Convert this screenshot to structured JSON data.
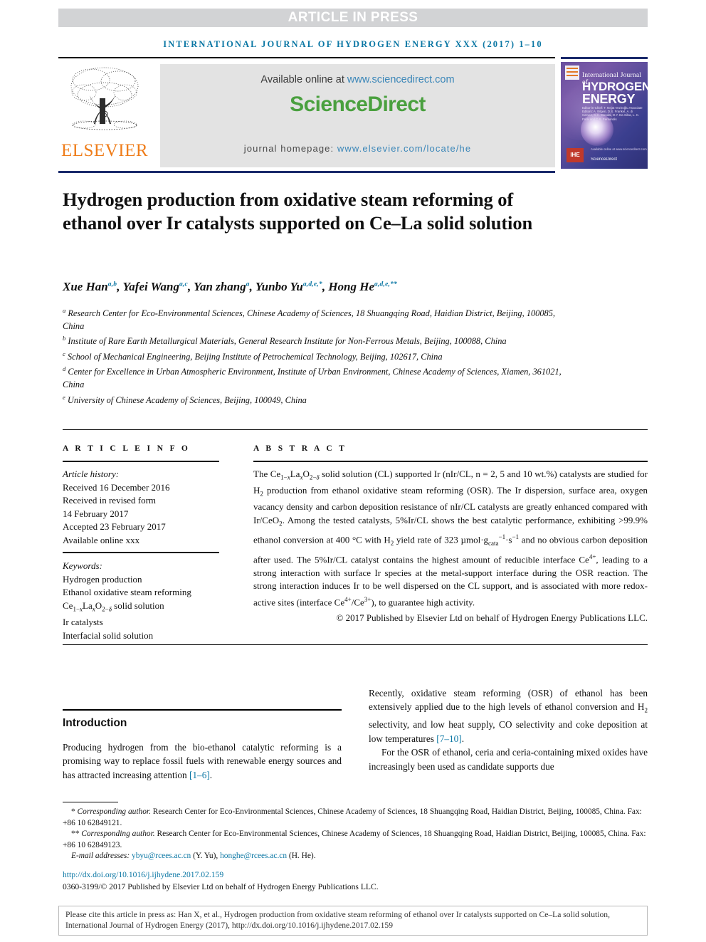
{
  "banner": {
    "article_in_press": "ARTICLE IN PRESS",
    "journal_running_head": "INTERNATIONAL JOURNAL OF HYDROGEN ENERGY XXX (2017) 1–10"
  },
  "masthead": {
    "elsevier_wordmark": "ELSEVIER",
    "available_online_label": "Available online at",
    "sciencedirect_url": "www.sciencedirect.com",
    "sciencedirect_logo": "ScienceDirect",
    "homepage_label": "journal homepage:",
    "homepage_url": "www.elsevier.com/locate/he",
    "cover": {
      "line1": "International Journal of",
      "line2": "HYDROGEN",
      "line3": "ENERGY",
      "editors": "Editor-in-Chief: T. Nejat Veziroğlu   Associate Editors: A. Bilgen, D.S. Frankel, A. di Carvez, K.C. Mondal, D.Y. Da Silva, L. C. Frick and C.S. Fernandis",
      "badge": "IHE",
      "sciencedirect_mark": "ScienceDirect",
      "available_line": "Available online at www.sciencedirect.com"
    }
  },
  "article": {
    "title": "Hydrogen production from oxidative steam reforming of ethanol over Ir catalysts supported on Ce–La solid solution",
    "authors": [
      {
        "name": "Xue Han",
        "marks": "a,b"
      },
      {
        "name": "Yafei Wang",
        "marks": "a,c"
      },
      {
        "name": "Yan zhang",
        "marks": "a"
      },
      {
        "name": "Yunbo Yu",
        "marks": "a,d,e,*"
      },
      {
        "name": "Hong He",
        "marks": "a,d,e,**"
      }
    ],
    "affiliations": [
      {
        "mark": "a",
        "text": "Research Center for Eco-Environmental Sciences, Chinese Academy of Sciences, 18 Shuangqing Road, Haidian District, Beijing, 100085, China"
      },
      {
        "mark": "b",
        "text": "Institute of Rare Earth Metallurgical Materials, General Research Institute for Non-Ferrous Metals, Beijing, 100088, China"
      },
      {
        "mark": "c",
        "text": "School of Mechanical Engineering, Beijing Institute of Petrochemical Technology, Beijing, 102617, China"
      },
      {
        "mark": "d",
        "text": "Center for Excellence in Urban Atmospheric Environment, Institute of Urban Environment, Chinese Academy of Sciences, Xiamen, 361021, China"
      },
      {
        "mark": "e",
        "text": "University of Chinese Academy of Sciences, Beijing, 100049, China"
      }
    ]
  },
  "article_info": {
    "heading": "A R T I C L E   I N F O",
    "history_label": "Article history:",
    "history": [
      "Received 16 December 2016",
      "Received in revised form",
      "14 February 2017",
      "Accepted 23 February 2017",
      "Available online xxx"
    ],
    "keywords_label": "Keywords:",
    "keywords": [
      "Hydrogen production",
      "Ethanol oxidative steam reforming",
      "Ir catalysts",
      "Interfacial solid solution"
    ],
    "keyword_formula_pre": "Ce",
    "keyword_formula_post": " solid solution"
  },
  "abstract": {
    "heading": "A B S T R A C T",
    "copyright": "© 2017 Published by Elsevier Ltd on behalf of Hydrogen Energy Publications LLC."
  },
  "introduction": {
    "heading": "Introduction",
    "left_paragraph_tail": " sources and has attracted increasing attention ",
    "left_cite": "[1–6]",
    "right_cite": "[7–10]",
    "right_para2": "For the OSR of ethanol, ceria and ceria-containing mixed oxides have increasingly been used as candidate supports due"
  },
  "footnotes": {
    "corresponding_1_label": "Corresponding author.",
    "corresponding_1": " Research Center for Eco-Environmental Sciences, Chinese Academy of Sciences, 18 Shuangqing Road, Haidian District, Beijing, 100085, China. Fax: +86 10 62849121.",
    "corresponding_2_label": "Corresponding author.",
    "corresponding_2": " Research Center for Eco-Environmental Sciences, Chinese Academy of Sciences, 18 Shuangqing Road, Haidian District, Beijing, 100085, China. Fax: +86 10 62849123.",
    "email_label": "E-mail addresses:",
    "email_1": "ybyu@rcees.ac.cn",
    "email_1_owner": " (Y. Yu), ",
    "email_2": "honghe@rcees.ac.cn",
    "email_2_owner": " (H. He).",
    "doi": "http://dx.doi.org/10.1016/j.ijhydene.2017.02.159",
    "issn": "0360-3199/© 2017 Published by Elsevier Ltd on behalf of Hydrogen Energy Publications LLC."
  },
  "cite_box": {
    "text": "Please cite this article in press as: Han X, et al., Hydrogen production from oxidative steam reforming of ethanol over Ir catalysts supported on Ce–La solid solution, International Journal of Hydrogen Energy (2017), http://dx.doi.org/10.1016/j.ijhydene.2017.02.159"
  },
  "colors": {
    "link_blue": "#0b77a4",
    "sciencedirect_green": "#4aa03f",
    "elsevier_orange": "#ef7d1a",
    "banner_gray": "#d2d3d5",
    "rule_navy": "#1a2a6b"
  }
}
